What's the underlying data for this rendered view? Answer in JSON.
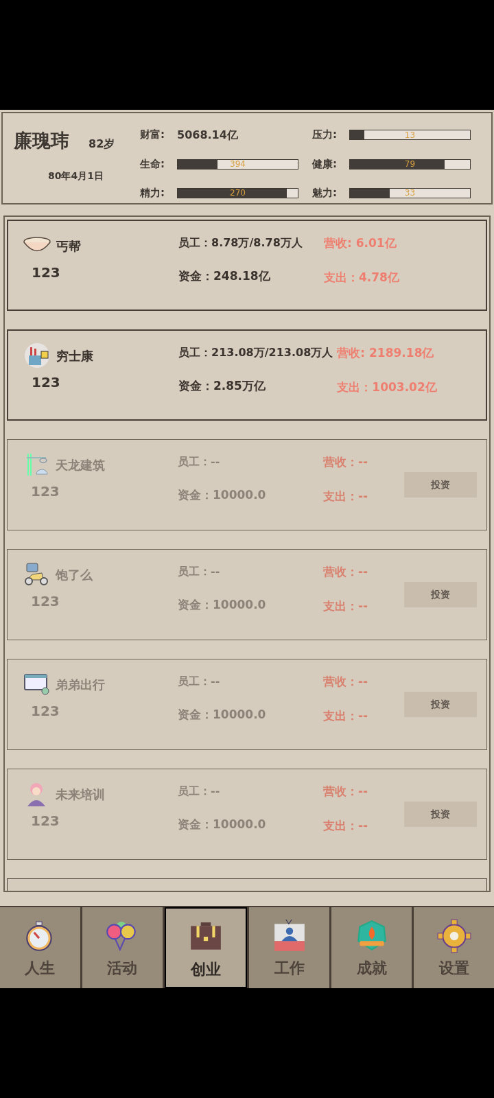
{
  "profile": {
    "name": "廉瑰玮",
    "age": "82岁",
    "date": "80年4月1日",
    "wealth_label": "财富:",
    "wealth": "5068.14亿",
    "stats": [
      {
        "label": "压力:",
        "value": "13",
        "level": 0.12
      },
      {
        "label": "生命:",
        "value": "394",
        "level": 0.33
      },
      {
        "label": "健康:",
        "value": "79",
        "level": 0.79
      },
      {
        "label": "精力:",
        "value": "270",
        "level": 0.91
      },
      {
        "label": "魅力:",
        "value": "33",
        "level": 0.33
      }
    ]
  },
  "companies": [
    {
      "kind": "active",
      "name": "丐帮",
      "level_text": "123",
      "staff": "员工：8.78万/8.78万人",
      "funds": "资金：248.18亿",
      "revenue": "营收: 6.01亿",
      "expense": "支出：4.78亿"
    },
    {
      "kind": "active",
      "name": "穷士康",
      "level_text": "123",
      "staff": "员工：213.08万/213.08万人",
      "funds": "资金：2.85万亿",
      "revenue": "营收: 2189.18亿",
      "expense": "支出：1003.02亿"
    },
    {
      "kind": "locked",
      "name": "天龙建筑",
      "level_text": "123",
      "staff": "员工：--",
      "funds": "资金：10000.0",
      "revenue": "营收：--",
      "expense": "支出：--",
      "button": "投资"
    },
    {
      "kind": "locked",
      "name": "饱了么",
      "level_text": "123",
      "staff": "员工：--",
      "funds": "资金：10000.0",
      "revenue": "营收：--",
      "expense": "支出：--",
      "button": "投资"
    },
    {
      "kind": "locked",
      "name": "弟弟出行",
      "level_text": "123",
      "staff": "员工：--",
      "funds": "资金：10000.0",
      "revenue": "营收：--",
      "expense": "支出：--",
      "button": "投资"
    },
    {
      "kind": "locked",
      "name": "未来培训",
      "level_text": "123",
      "staff": "员工：--",
      "funds": "资金：10000.0",
      "revenue": "营收：--",
      "expense": "支出：--",
      "button": "投资"
    },
    {
      "kind": "cut"
    }
  ],
  "nav": [
    {
      "label": "人生",
      "selected": false
    },
    {
      "label": "活动",
      "selected": false
    },
    {
      "label": "创业",
      "selected": true
    },
    {
      "label": "工作",
      "selected": false
    },
    {
      "label": "成就",
      "selected": false
    },
    {
      "label": "设置",
      "selected": false
    }
  ]
}
